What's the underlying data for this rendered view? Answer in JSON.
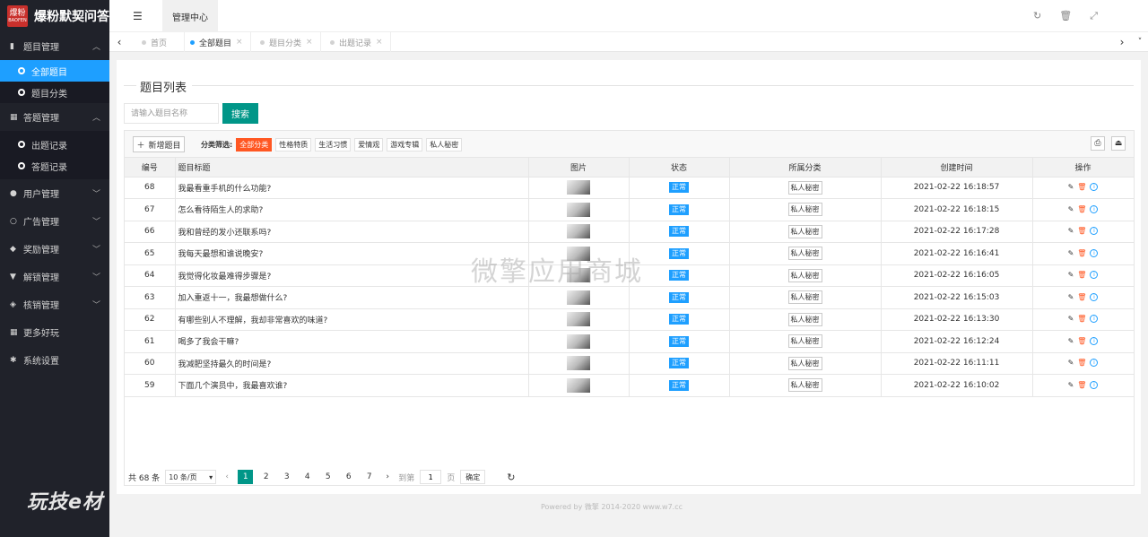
{
  "app": {
    "logo_badge": "爆粉",
    "logo_badge_sub": "BAOFEN",
    "title": "爆粉默契问答"
  },
  "sidebar": {
    "groups": [
      {
        "label": "题目管理",
        "icon": "book-icon",
        "expanded": true,
        "items": [
          {
            "label": "全部题目",
            "active": true
          },
          {
            "label": "题目分类",
            "active": false
          }
        ]
      },
      {
        "label": "答题管理",
        "icon": "calendar-icon",
        "expanded": true,
        "items": [
          {
            "label": "出题记录",
            "active": false
          },
          {
            "label": "答题记录",
            "active": false
          }
        ]
      },
      {
        "label": "用户管理",
        "icon": "users-icon",
        "expanded": false
      },
      {
        "label": "广告管理",
        "icon": "circle-icon",
        "expanded": false
      },
      {
        "label": "奖励管理",
        "icon": "gift-icon",
        "expanded": false
      },
      {
        "label": "解锁管理",
        "icon": "cart-icon",
        "expanded": false
      },
      {
        "label": "核销管理",
        "icon": "tag-icon",
        "expanded": false
      },
      {
        "label": "更多好玩",
        "icon": "grid-icon",
        "expanded": null
      },
      {
        "label": "系统设置",
        "icon": "gear-icon",
        "expanded": null
      }
    ],
    "bottom_watermark": "玩技e材"
  },
  "header": {
    "menu_toggle_icon": "hamburger-icon",
    "tab_label": "管理中心",
    "icons": [
      "refresh-icon",
      "trash-icon",
      "fullscreen-icon"
    ]
  },
  "tabs": [
    {
      "label": "首页",
      "active": false,
      "closable": false
    },
    {
      "label": "全部题目",
      "active": true,
      "closable": true
    },
    {
      "label": "题目分类",
      "active": false,
      "closable": true
    },
    {
      "label": "出题记录",
      "active": false,
      "closable": true
    }
  ],
  "page": {
    "title": "题目列表",
    "search_placeholder": "请输入题目名称",
    "search_button": "搜索",
    "add_button": "新增题目",
    "filter_label": "分类筛选:",
    "filters": [
      {
        "label": "全部分类",
        "active": true
      },
      {
        "label": "性格特质",
        "active": false
      },
      {
        "label": "生活习惯",
        "active": false
      },
      {
        "label": "爱情观",
        "active": false
      },
      {
        "label": "游戏专辑",
        "active": false
      },
      {
        "label": "私人秘密",
        "active": false
      }
    ],
    "columns": [
      "编号",
      "题目标题",
      "图片",
      "状态",
      "所属分类",
      "创建时间",
      "操作"
    ],
    "rows": [
      {
        "id": "68",
        "title": "我最看重手机的什么功能?",
        "status": "正常",
        "category": "私人秘密",
        "created": "2021-02-22 16:18:57"
      },
      {
        "id": "67",
        "title": "怎么看待陌生人的求助?",
        "status": "正常",
        "category": "私人秘密",
        "created": "2021-02-22 16:18:15"
      },
      {
        "id": "66",
        "title": "我和曾经的发小还联系吗?",
        "status": "正常",
        "category": "私人秘密",
        "created": "2021-02-22 16:17:28"
      },
      {
        "id": "65",
        "title": "我每天最想和谁说晚安?",
        "status": "正常",
        "category": "私人秘密",
        "created": "2021-02-22 16:16:41"
      },
      {
        "id": "64",
        "title": "我觉得化妆最难得步骤是?",
        "status": "正常",
        "category": "私人秘密",
        "created": "2021-02-22 16:16:05"
      },
      {
        "id": "63",
        "title": "加入重返十一，我最想做什么?",
        "status": "正常",
        "category": "私人秘密",
        "created": "2021-02-22 16:15:03"
      },
      {
        "id": "62",
        "title": "有哪些别人不理解，我却非常喜欢的味道?",
        "status": "正常",
        "category": "私人秘密",
        "created": "2021-02-22 16:13:30"
      },
      {
        "id": "61",
        "title": "喝多了我会干嘛?",
        "status": "正常",
        "category": "私人秘密",
        "created": "2021-02-22 16:12:24"
      },
      {
        "id": "60",
        "title": "我减肥坚持最久的时间是?",
        "status": "正常",
        "category": "私人秘密",
        "created": "2021-02-22 16:11:11"
      },
      {
        "id": "59",
        "title": "下面几个演员中，我最喜欢谁?",
        "status": "正常",
        "category": "私人秘密",
        "created": "2021-02-22 16:10:02"
      }
    ],
    "pager": {
      "total": "共 68 条",
      "page_size": "10 条/页",
      "pages": [
        "1",
        "2",
        "3",
        "4",
        "5",
        "6",
        "7"
      ],
      "current": "1",
      "goto_label": "到第",
      "goto_value": "1",
      "page_suffix": "页",
      "confirm": "确定"
    }
  },
  "footer": "Powered by 微擎 2014-2020 www.w7.cc",
  "overlay_watermark": "微擎应用商城"
}
